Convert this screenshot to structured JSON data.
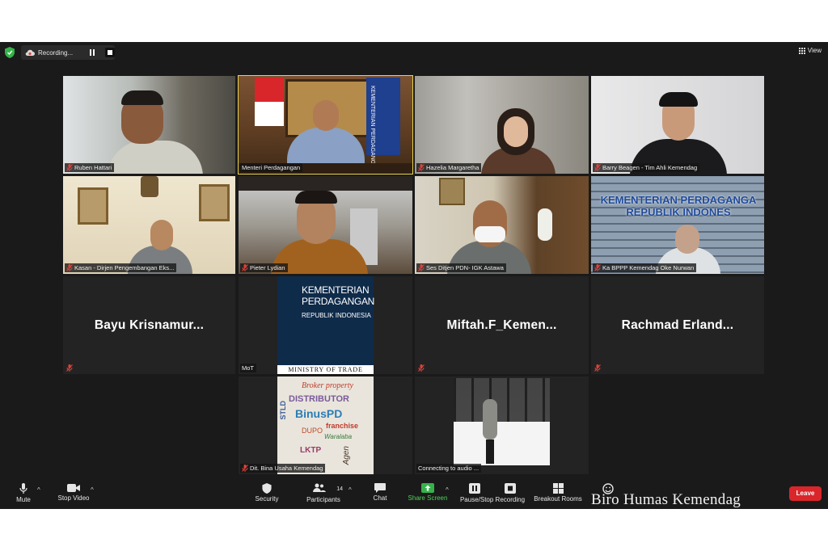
{
  "topbar": {
    "recording_label": "Recording...",
    "view_label": "View"
  },
  "participants": [
    {
      "name": "Ruben Hattari"
    },
    {
      "name": "Menteri Perdagangan"
    },
    {
      "name": "Hazelia Margaretha"
    },
    {
      "name": "Barry Beagen - Tim Ahli Kemendag"
    },
    {
      "name": "Kasan - Dirjen Pengembangan Eks..."
    },
    {
      "name": "Pieter Lydian"
    },
    {
      "name": "Ses Ditjen PDN- IGK Astawa"
    },
    {
      "name": "Ka BPPP Kemendag Oke Nurwan"
    },
    {
      "name": "Bayu  Krisnamur..."
    },
    {
      "name": "MoT"
    },
    {
      "name": "Miftah.F_Kemen..."
    },
    {
      "name": "Rachmad  Erland..."
    },
    {
      "name": "Dit. Bina Usaha Kemendag"
    },
    {
      "name": "Connecting to audio ..."
    }
  ],
  "mot_logo": {
    "line1": "KEMENTERIAN",
    "line2": "PERDAGANGAN",
    "line3": "REPUBLIK INDONESIA",
    "footer": "MINISTRY OF TRADE"
  },
  "building_sign": {
    "line1": "KEMENTERIAN PERDAGANGA",
    "line2": "REPUBLIK INDONES"
  },
  "flag_text": "KEMENTERIAN PERDAGANGAN",
  "word_cloud": [
    "Broker property",
    "DISTRIBUTOR",
    "BinusPD",
    "franchise",
    "LKTP",
    "DUPO",
    "Waralaba",
    "STLD",
    "Agen"
  ],
  "toolbar": {
    "mute": "Mute",
    "stop_video": "Stop Video",
    "security": "Security",
    "participants": "Participants",
    "participants_count": "14",
    "chat": "Chat",
    "share_screen": "Share Screen",
    "pause_stop": "Pause/Stop Recording",
    "breakout": "Breakout Rooms",
    "leave": "Leave"
  },
  "watermark": "Biro Humas Kemendag",
  "colors": {
    "active_speaker": "#e8d44a",
    "muted_icon": "#e0413b",
    "share_green": "#4fd05b",
    "leave_red": "#d9262b"
  }
}
